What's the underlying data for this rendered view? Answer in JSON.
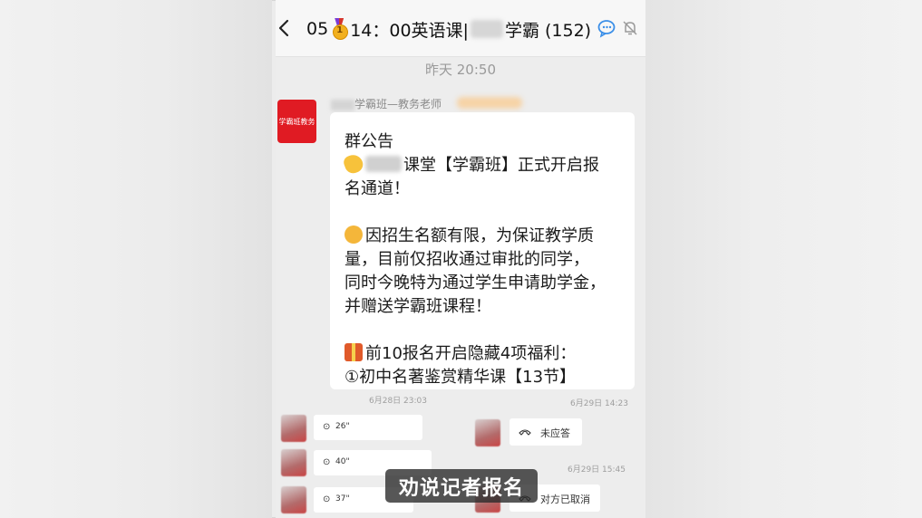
{
  "header": {
    "title_prefix": "05",
    "title_time": "14：00英语课|",
    "title_suffix": "学霸 (152)"
  },
  "chat": {
    "date_label": "昨天 20:50",
    "announcement": {
      "avatar_text": "学霸班教务",
      "sender_name": "学霸班—教务老师",
      "lines": [
        "群公告",
        "课堂【学霸班】正式开启报",
        "名通道！",
        "因招生名额有限，为保证教学质",
        "量，目前仅招收通过审批的同学，",
        "同时今晚特为通过学生申请助学金，",
        "并赠送学霸班课程！",
        "前10报名开启隐藏4项福利：",
        "①初中名著鉴赏精华课【13节】"
      ]
    },
    "left_timestamp": "6月28日 23:03",
    "right_timestamp_1": "6月29日 14:23",
    "right_timestamp_2": "6月29日 15:45",
    "voice_messages": [
      "26\"",
      "40\"",
      "37\""
    ],
    "calls": [
      "未应答",
      "对方已取消"
    ]
  },
  "subtitle": "劝说记者报名",
  "colors": {
    "avatar_red": "#e01b23",
    "chat_bg": "#ededed"
  }
}
